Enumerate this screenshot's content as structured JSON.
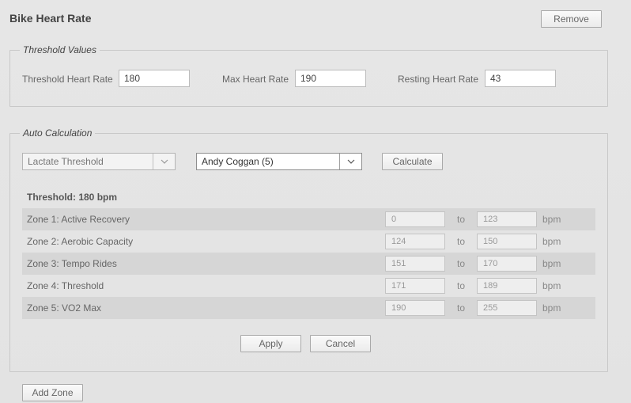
{
  "header": {
    "title": "Bike Heart Rate",
    "remove_label": "Remove"
  },
  "threshold_values": {
    "legend": "Threshold Values",
    "threshold_hr": {
      "label": "Threshold Heart Rate",
      "value": "180"
    },
    "max_hr": {
      "label": "Max Heart Rate",
      "value": "190"
    },
    "resting_hr": {
      "label": "Resting Heart Rate",
      "value": "43"
    }
  },
  "auto_calc": {
    "legend": "Auto Calculation",
    "method_select": "Lactate Threshold",
    "model_select": "Andy Coggan (5)",
    "calculate_label": "Calculate",
    "threshold_summary": "Threshold: 180 bpm",
    "to_label": "to",
    "unit_label": "bpm",
    "zones": [
      {
        "name": "Zone 1: Active Recovery",
        "from": "0",
        "to": "123"
      },
      {
        "name": "Zone 2: Aerobic Capacity",
        "from": "124",
        "to": "150"
      },
      {
        "name": "Zone 3: Tempo Rides",
        "from": "151",
        "to": "170"
      },
      {
        "name": "Zone 4: Threshold",
        "from": "171",
        "to": "189"
      },
      {
        "name": "Zone 5: VO2 Max",
        "from": "190",
        "to": "255"
      }
    ],
    "apply_label": "Apply",
    "cancel_label": "Cancel"
  },
  "add_zone_label": "Add Zone"
}
